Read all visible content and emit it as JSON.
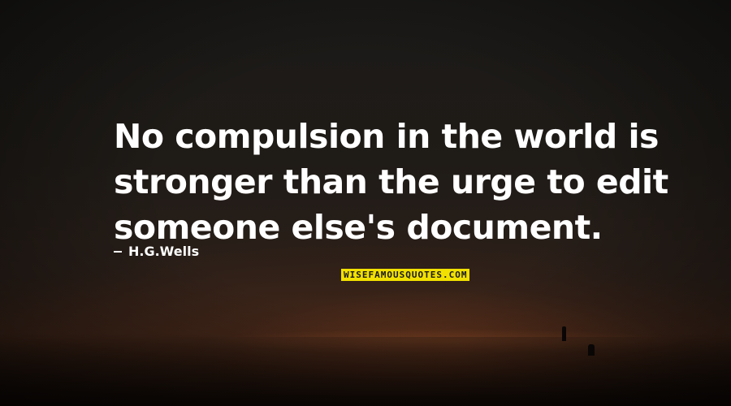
{
  "quote": {
    "lines": [
      "No compulsion in the world is",
      "stronger than the urge to edit",
      "someone else's document."
    ]
  },
  "author": {
    "dash": "-",
    "name": "H.G.Wells"
  },
  "watermark": {
    "text": "WISEFAMOUSQUOTES.COM"
  },
  "colors": {
    "text": "#ffffff",
    "watermark_bg": "#f2e000",
    "background": "#1a1512"
  }
}
